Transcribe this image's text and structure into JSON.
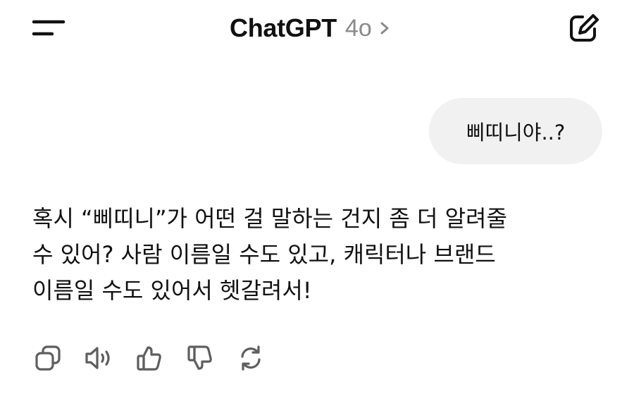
{
  "header": {
    "title": "ChatGPT",
    "model": "4o",
    "menu_icon": "menu-icon",
    "chevron_icon": "chevron-right-icon",
    "new_chat_icon": "edit-icon"
  },
  "messages": {
    "user": "삐띠니야..?",
    "assistant_lines": [
      "혹시 “삐띠니”가 어떤 걸 말하는 건지 좀 더 알려줄",
      "수 있어? 사람 이름일 수도 있고, 캐릭터나 브랜드",
      "이름일 수도 있어서 헷갈려서!"
    ]
  },
  "actions": [
    "copy-icon",
    "speaker-icon",
    "thumbs-up-icon",
    "thumbs-down-icon",
    "regenerate-icon"
  ],
  "colors": {
    "text": "#111111",
    "muted": "#8a8a8a",
    "bubble": "#f1f1f1",
    "icon": "#5e5e5e"
  }
}
